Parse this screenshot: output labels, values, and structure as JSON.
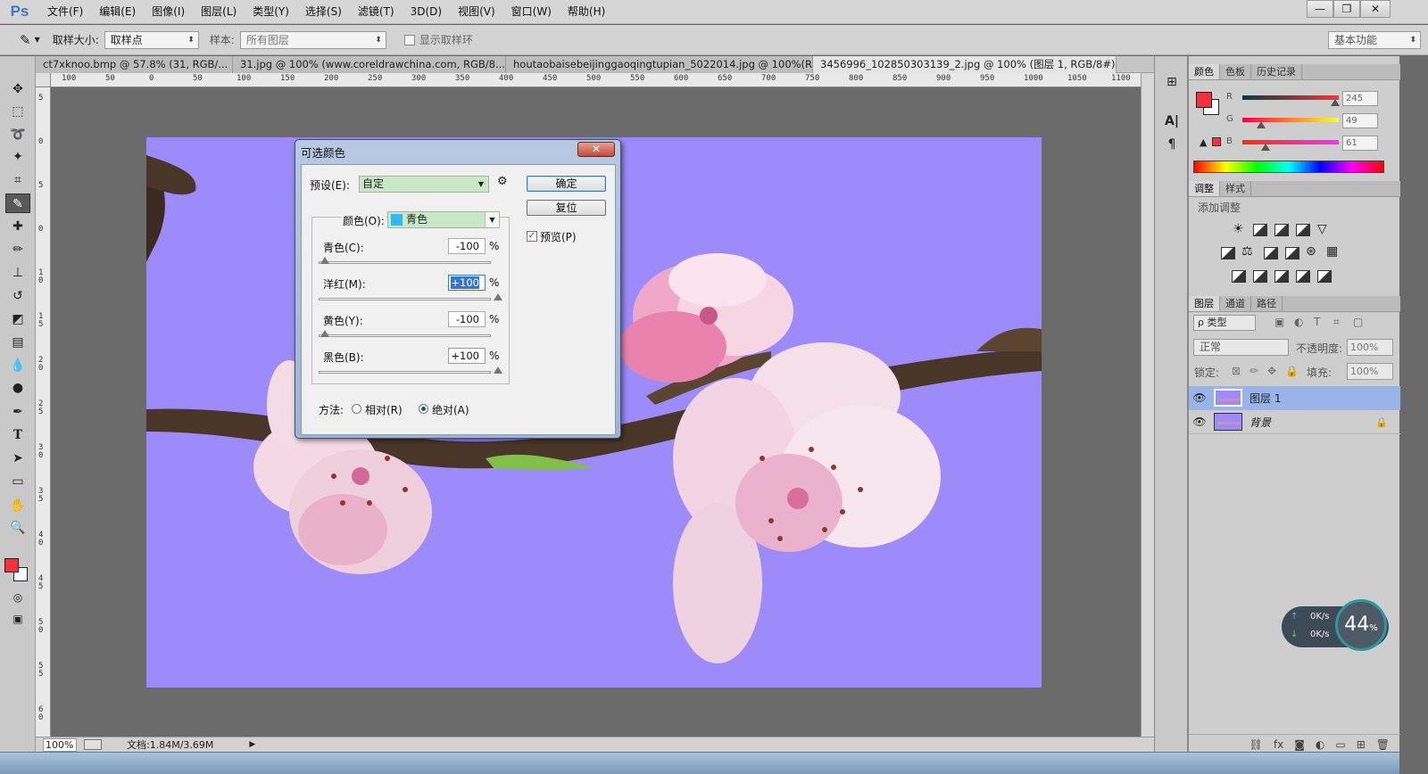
{
  "app": {
    "logo": "Ps"
  },
  "menu": [
    "文件(F)",
    "编辑(E)",
    "图像(I)",
    "图层(L)",
    "类型(Y)",
    "选择(S)",
    "滤镜(T)",
    "3D(D)",
    "视图(V)",
    "窗口(W)",
    "帮助(H)"
  ],
  "window_controls": {
    "minimize": "—",
    "restore": "❐",
    "close": "✕"
  },
  "options": {
    "sample_size_label": "取样大小:",
    "sample_size_value": "取样点",
    "sample_label": "样本:",
    "sample_value": "所有图层",
    "show_ring_label": "显示取样环",
    "workspace": "基本功能"
  },
  "tabs": [
    {
      "label": "ct7xknoo.bmp @ 57.8% (31, RGB/...",
      "close": "×"
    },
    {
      "label": "31.jpg @ 100% (www.coreldrawchina.com, RGB/8...",
      "close": "×"
    },
    {
      "label": "houtaobaisebeijinggaoqingtupian_5022014.jpg @ 100%(R...",
      "close": "×"
    },
    {
      "label": "3456996_102850303139_2.jpg @ 100% (图层 1, RGB/8#) *",
      "close": "×"
    }
  ],
  "hruler": [
    "100",
    "50",
    "0",
    "50",
    "100",
    "150",
    "200",
    "250",
    "300",
    "350",
    "400",
    "450",
    "500",
    "550",
    "600",
    "650",
    "700",
    "750",
    "800",
    "850",
    "900",
    "950",
    "1000",
    "1050",
    "1100"
  ],
  "vruler": [
    "5",
    "0",
    "5",
    "0",
    "1 0",
    "1 5",
    "2 0",
    "2 5",
    "3 0",
    "3 5",
    "4 0",
    "4 5",
    "5 0",
    "5 5",
    "6 0"
  ],
  "status": {
    "zoom": "100%",
    "doc": "文档:1.84M/3.69M"
  },
  "dialog": {
    "title": "可选颜色",
    "close": "✕",
    "preset_label": "预设(E):",
    "preset_value": "自定",
    "ok": "确定",
    "reset": "复位",
    "preview_label": "预览(P)",
    "color_label": "颜色(O):",
    "color_value": "青色",
    "color_swatch": "#30b8f0",
    "sliders": [
      {
        "label": "青色(C):",
        "value": "-100",
        "unit": "%",
        "level": 0
      },
      {
        "label": "洋红(M):",
        "value": "+100",
        "unit": "%",
        "level": 1
      },
      {
        "label": "黄色(Y):",
        "value": "-100",
        "unit": "%",
        "level": 0
      },
      {
        "label": "黑色(B):",
        "value": "+100",
        "unit": "%",
        "level": 1
      }
    ],
    "method_label": "方法:",
    "relative_label": "相对(R)",
    "absolute_label": "绝对(A)"
  },
  "color_panel": {
    "tabs": [
      "颜色",
      "色板",
      "历史记录"
    ],
    "foreground": "#f5313d",
    "channels": [
      {
        "name": "R",
        "value": "245",
        "level": 0.96
      },
      {
        "name": "G",
        "value": "49",
        "level": 0.19
      },
      {
        "name": "B",
        "value": "61",
        "level": 0.24
      }
    ]
  },
  "adjust_panel": {
    "tabs": [
      "调整",
      "样式"
    ],
    "title": "添加调整"
  },
  "layers_panel": {
    "tabs": [
      "图层",
      "通道",
      "路径"
    ],
    "filter": "ρ 类型",
    "blend": "正常",
    "opacity_label": "不透明度:",
    "opacity": "100%",
    "lock_label": "锁定:",
    "fill_label": "填充:",
    "fill": "100%",
    "layers": [
      {
        "name": "图层 1",
        "selected": true
      },
      {
        "name": "背景",
        "selected": false
      }
    ]
  },
  "speed_widget": {
    "up": "0K/s",
    "down": "0K/s",
    "percent": "44",
    "unit": "%"
  },
  "colors": {
    "canvas_bg": "#9d8bfa",
    "accent": "#3375d4"
  }
}
